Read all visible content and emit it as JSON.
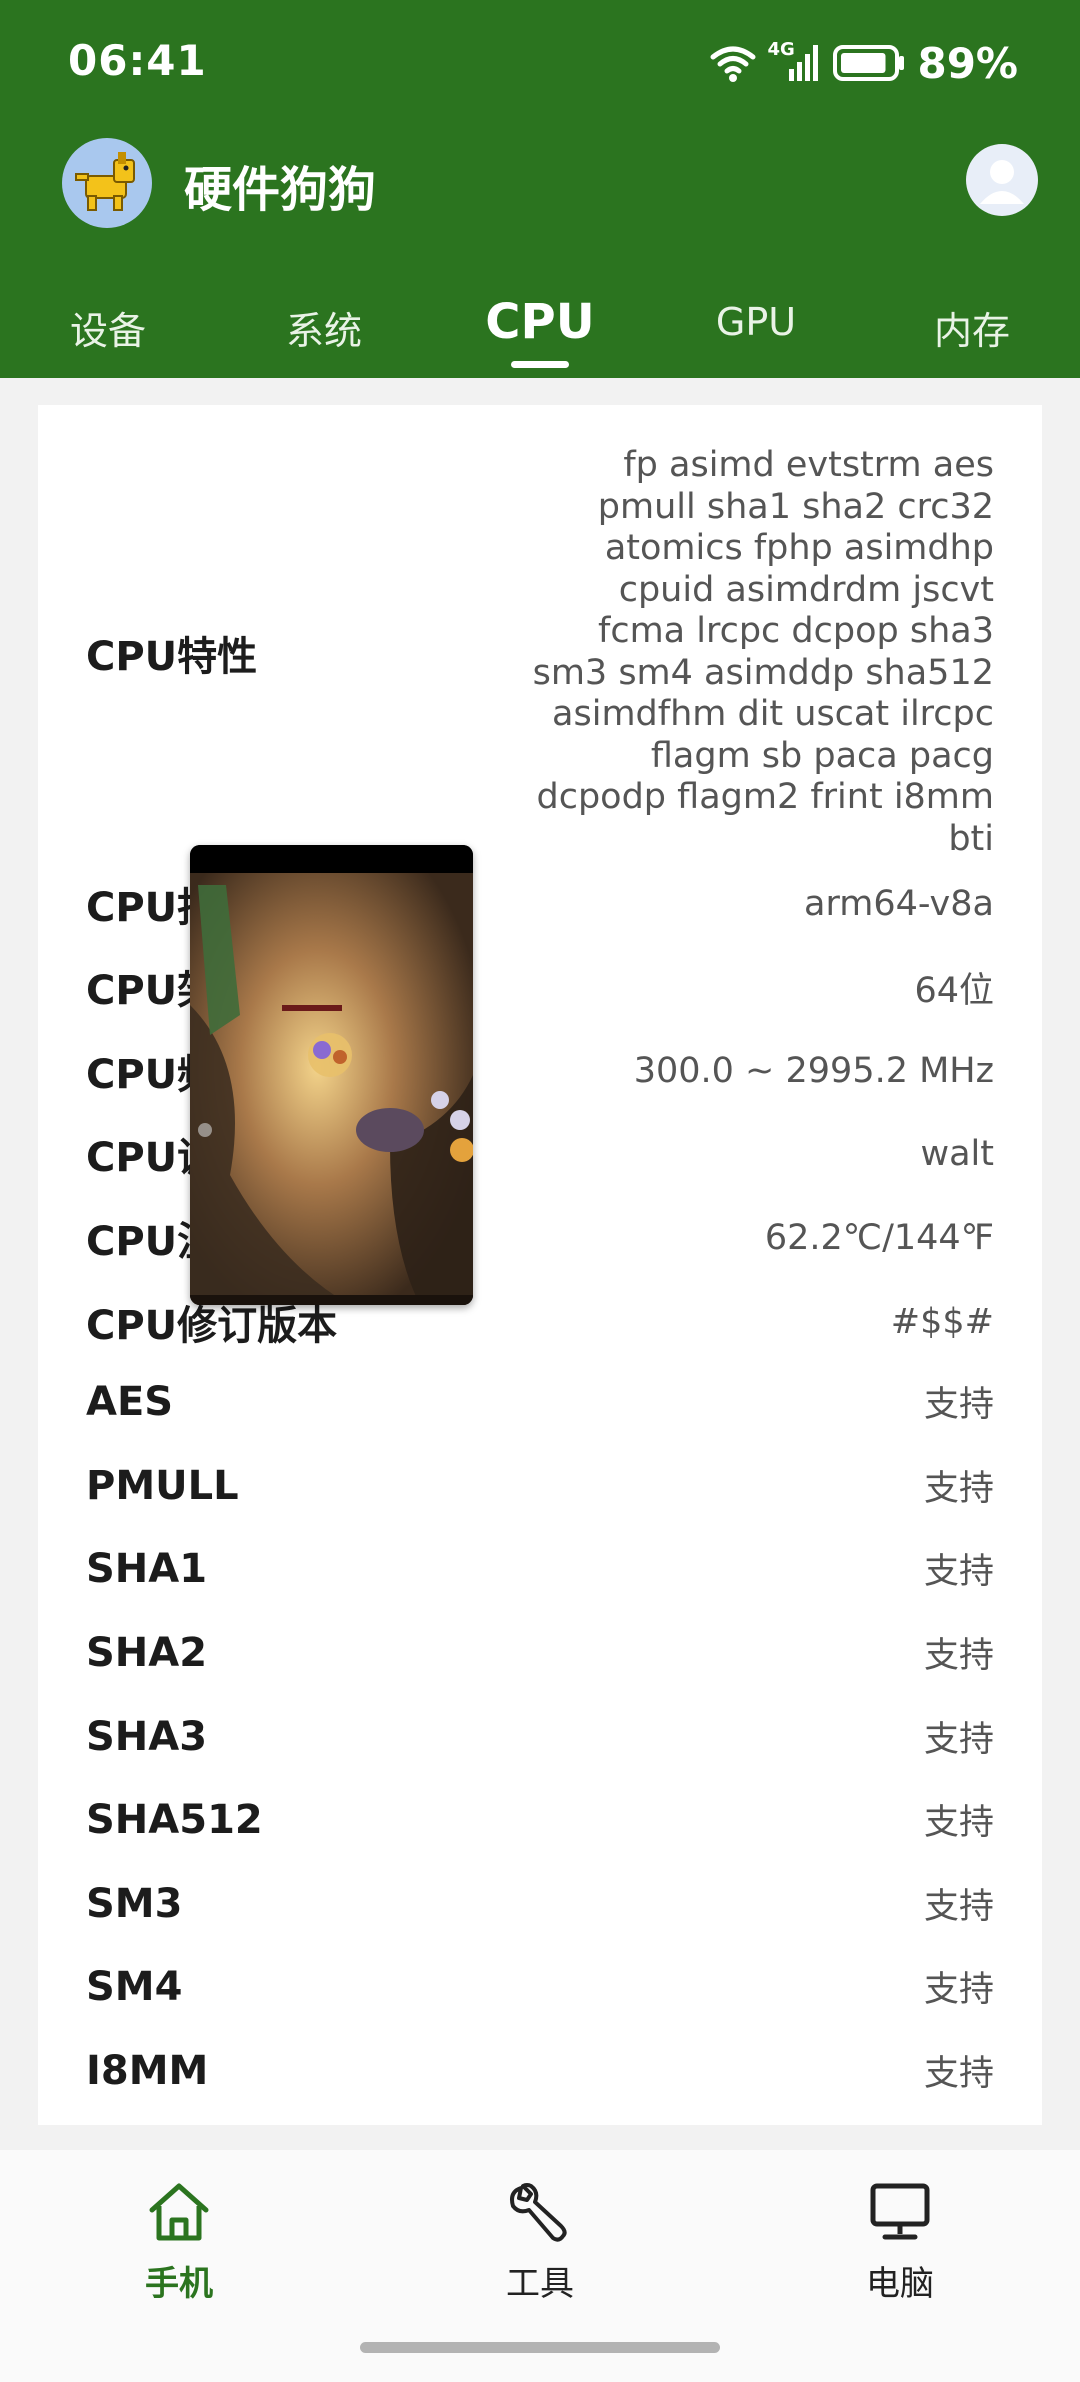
{
  "status_bar": {
    "time": "06:41",
    "network": "4G",
    "battery_percent": "89%",
    "battery_level": 0.89
  },
  "app": {
    "title": "硬件狗狗"
  },
  "tabs": [
    {
      "label": "设备"
    },
    {
      "label": "系统"
    },
    {
      "label": "CPU"
    },
    {
      "label": "GPU"
    },
    {
      "label": "内存"
    }
  ],
  "active_tab": "CPU",
  "cpu_info": {
    "features_label": "CPU特性",
    "features_value": "fp asimd evtstrm aes pmull sha1 sha2 crc32 atomics fphp asimdhp cpuid asimdrdm jscvt fcma lrcpc dcpop sha3 sm3 sm4 asimddp sha512 asimdfhm dit uscat ilrcpc flagm sb paca pacg dcpodp flagm2 frint i8mm bti",
    "rows": [
      {
        "label": "CPU指",
        "value": "arm64-v8a"
      },
      {
        "label": "CPU架",
        "value": "64位"
      },
      {
        "label": "CPU频",
        "value": "300.0 ~ 2995.2 MHz"
      },
      {
        "label": "CPU调",
        "value": "walt"
      },
      {
        "label": "CPU温",
        "value": "62.2℃/144℉"
      },
      {
        "label": "CPU修订版本",
        "value": "#$$#"
      },
      {
        "label": "AES",
        "value": "支持"
      },
      {
        "label": "PMULL",
        "value": "支持"
      },
      {
        "label": "SHA1",
        "value": "支持"
      },
      {
        "label": "SHA2",
        "value": "支持"
      },
      {
        "label": "SHA3",
        "value": "支持"
      },
      {
        "label": "SHA512",
        "value": "支持"
      },
      {
        "label": "SM3",
        "value": "支持"
      },
      {
        "label": "SM4",
        "value": "支持"
      },
      {
        "label": "I8MM",
        "value": "支持"
      }
    ]
  },
  "bottom_nav": [
    {
      "label": "手机",
      "icon": "home-icon"
    },
    {
      "label": "工具",
      "icon": "wrench-icon"
    },
    {
      "label": "电脑",
      "icon": "monitor-icon"
    }
  ],
  "colors": {
    "primary": "#2b741f",
    "text": "#1c1c1c",
    "secondary_text": "#555555"
  }
}
